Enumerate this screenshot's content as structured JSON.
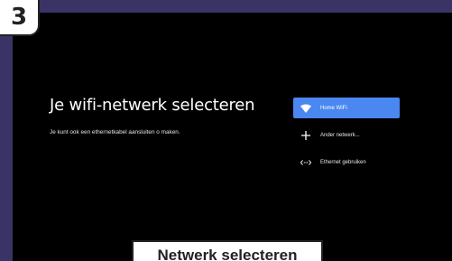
{
  "step": {
    "number": "3"
  },
  "screen": {
    "title": "Je wifi-netwerk selecteren",
    "subtitle": "Je kunt ook een ethernetkabel aansluiten o maken.",
    "networks": [
      {
        "label": "Home WiFi",
        "icon": "wifi-icon",
        "selected": true
      },
      {
        "label": "Ander netwerk...",
        "icon": "plus-icon",
        "selected": false
      },
      {
        "label": "Ethernet gebruiken",
        "icon": "ethernet-icon",
        "selected": false
      }
    ],
    "accent_color": "#4a87f0"
  },
  "caption": {
    "text": "Netwerk selecteren"
  }
}
